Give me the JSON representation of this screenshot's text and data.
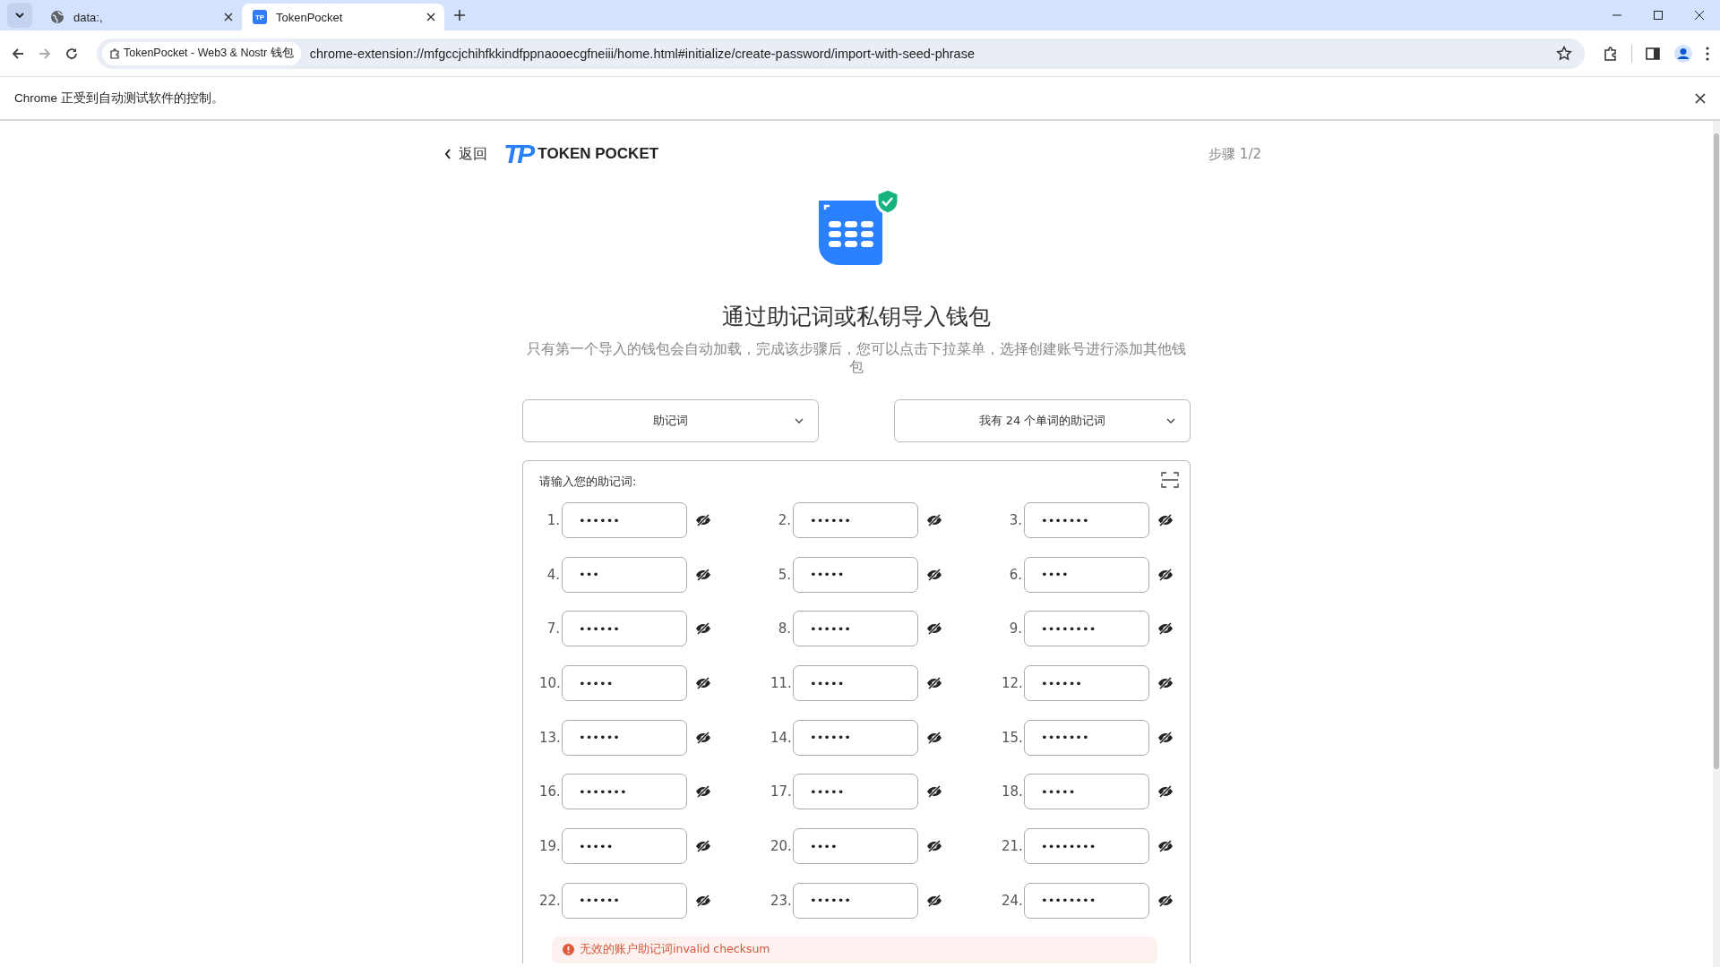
{
  "browser": {
    "tabs": [
      {
        "title": "data:,",
        "kind": "web",
        "selected": false
      },
      {
        "title": "TokenPocket",
        "kind": "app",
        "favicon_text": "TP",
        "selected": true
      }
    ],
    "site_chip": "TokenPocket - Web3 & Nostr 钱包",
    "url": "chrome-extension://mfgccjchihfkkindfppnaooecgfneiii/home.html#initialize/create-password/import-with-seed-phrase",
    "infobar": "Chrome 正受到自动测试软件的控制。"
  },
  "header": {
    "back": "返回",
    "logo_mark": "TP",
    "logo_text": "TOKEN POCKET",
    "step": "步骤 1/2"
  },
  "title": "通过助记词或私钥导入钱包",
  "subtitle": "只有第一个导入的钱包会自动加载，完成该步骤后，您可以点击下拉菜单，选择创建账号进行添加其他钱包",
  "dropdowns": [
    "助记词",
    "我有 24 个单词的助记词"
  ],
  "phrase": {
    "label": "请输入您的助记词:",
    "words": [
      {
        "number": "1.",
        "value": "••••••"
      },
      {
        "number": "2.",
        "value": "••••••"
      },
      {
        "number": "3.",
        "value": "•••••••"
      },
      {
        "number": "4.",
        "value": "•••"
      },
      {
        "number": "5.",
        "value": "•••••"
      },
      {
        "number": "6.",
        "value": "••••"
      },
      {
        "number": "7.",
        "value": "••••••"
      },
      {
        "number": "8.",
        "value": "••••••"
      },
      {
        "number": "9.",
        "value": "••••••••"
      },
      {
        "number": "10.",
        "value": "•••••"
      },
      {
        "number": "11.",
        "value": "•••••"
      },
      {
        "number": "12.",
        "value": "••••••"
      },
      {
        "number": "13.",
        "value": "••••••"
      },
      {
        "number": "14.",
        "value": "••••••"
      },
      {
        "number": "15.",
        "value": "•••••••"
      },
      {
        "number": "16.",
        "value": "•••••••"
      },
      {
        "number": "17.",
        "value": "•••••"
      },
      {
        "number": "18.",
        "value": "•••••"
      },
      {
        "number": "19.",
        "value": "•••••"
      },
      {
        "number": "20.",
        "value": "••••"
      },
      {
        "number": "21.",
        "value": "••••••••"
      },
      {
        "number": "22.",
        "value": "••••••"
      },
      {
        "number": "23.",
        "value": "••••••"
      },
      {
        "number": "24.",
        "value": "••••••••"
      }
    ],
    "error": "无效的账户助记词invalid checksum"
  }
}
